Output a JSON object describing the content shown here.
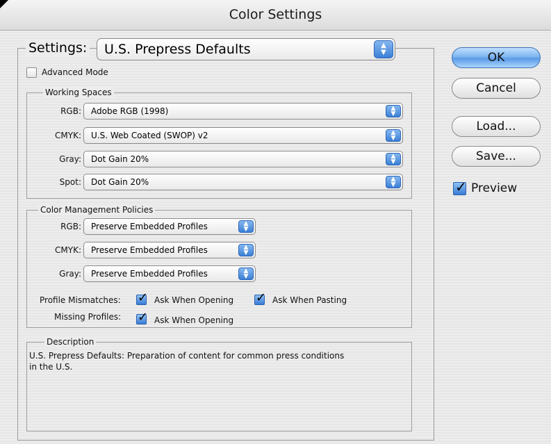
{
  "window": {
    "title": "Color Settings"
  },
  "settings": {
    "label": "Settings:",
    "value": "U.S. Prepress Defaults"
  },
  "advanced_mode": {
    "label": "Advanced Mode",
    "checked": false
  },
  "working_spaces": {
    "title": "Working Spaces",
    "rows": [
      {
        "label": "RGB:",
        "value": "Adobe RGB (1998)"
      },
      {
        "label": "CMYK:",
        "value": "U.S. Web Coated (SWOP) v2"
      },
      {
        "label": "Gray:",
        "value": "Dot Gain 20%"
      },
      {
        "label": "Spot:",
        "value": "Dot Gain 20%"
      }
    ]
  },
  "policies": {
    "title": "Color Management Policies",
    "rows": [
      {
        "label": "RGB:",
        "value": "Preserve Embedded Profiles"
      },
      {
        "label": "CMYK:",
        "value": "Preserve Embedded Profiles"
      },
      {
        "label": "Gray:",
        "value": "Preserve Embedded Profiles"
      }
    ],
    "profile_mismatches": {
      "label": "Profile Mismatches:",
      "ask_opening": "Ask When Opening",
      "ask_pasting": "Ask When Pasting"
    },
    "missing_profiles": {
      "label": "Missing Profiles:",
      "ask_opening": "Ask When Opening"
    }
  },
  "description": {
    "title": "Description",
    "text_line1": "U.S. Prepress Defaults:  Preparation of content for common press conditions",
    "text_line2": "in the U.S."
  },
  "buttons": {
    "ok": "OK",
    "cancel": "Cancel",
    "load": "Load...",
    "save": "Save..."
  },
  "preview": {
    "label": "Preview",
    "checked": true
  },
  "colors": {
    "accent": "#5b9be6",
    "background": "#ececec"
  }
}
